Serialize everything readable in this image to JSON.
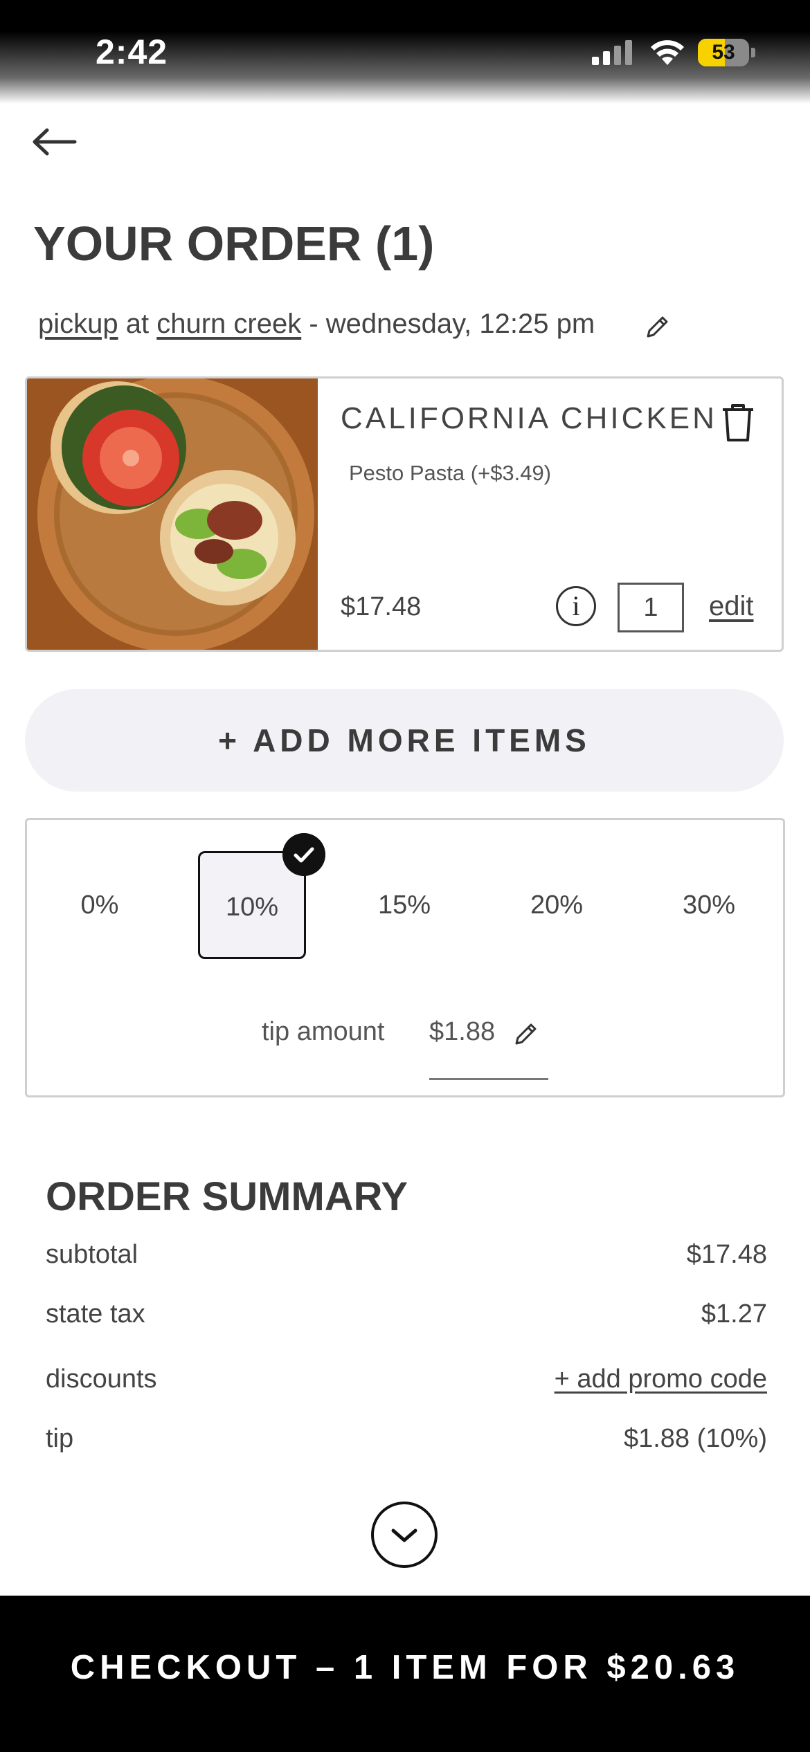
{
  "status_bar": {
    "time": "2:42",
    "battery": "53",
    "battery_level": 0.53
  },
  "header": {
    "title": "YOUR ORDER (1)"
  },
  "pickup": {
    "method": "pickup",
    "at": "at",
    "location": "churn creek",
    "when": "- wednesday, 12:25 pm"
  },
  "item": {
    "name": "CALIFORNIA CHICKEN",
    "modifier": "Pesto Pasta (+$3.49)",
    "price": "$17.48",
    "info_glyph": "i",
    "quantity": "1",
    "edit_label": "edit",
    "image_icon": "sandwich-photo"
  },
  "add_more": {
    "label": "+ ADD MORE ITEMS"
  },
  "tip": {
    "options": [
      "0%",
      "10%",
      "15%",
      "20%",
      "30%"
    ],
    "selected": "10%",
    "amount_label": "tip amount",
    "amount": "$1.88"
  },
  "summary": {
    "title": "ORDER SUMMARY",
    "rows": [
      {
        "label": "subtotal",
        "value": "$17.48"
      },
      {
        "label": "state tax",
        "value": "$1.27"
      },
      {
        "label": "discounts",
        "value": "+ add promo code"
      },
      {
        "label": "tip",
        "value": "$1.88 (10%)"
      }
    ]
  },
  "checkout": {
    "label": "CHECKOUT – 1 ITEM FOR $20.63"
  },
  "colors": {
    "checkout_bg": "#000000",
    "battery": "#f7d100",
    "add_more_bg": "#f2f2f6"
  }
}
